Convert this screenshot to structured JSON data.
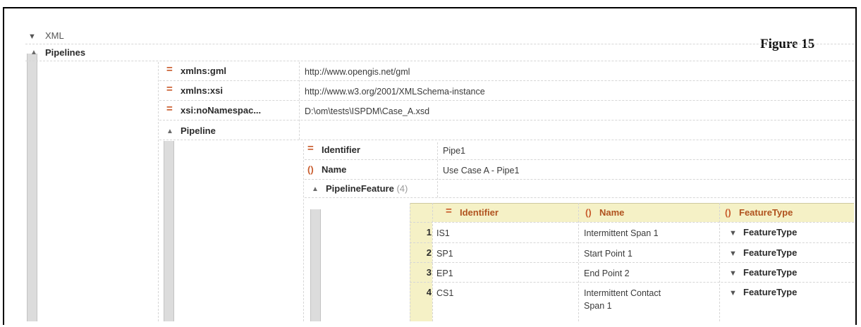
{
  "figure_label": "Figure 15",
  "root": {
    "label": "XML"
  },
  "pipelines": {
    "label": "Pipelines",
    "attributes": [
      {
        "name": "xmlns:gml",
        "value": "http://www.opengis.net/gml"
      },
      {
        "name": "xmlns:xsi",
        "value": "http://www.w3.org/2001/XMLSchema-instance"
      },
      {
        "name": "xsi:noNamespac...",
        "value": "D:\\om\\tests\\ISPDM\\Case_A.xsd"
      }
    ],
    "pipeline": {
      "label": "Pipeline",
      "identifier": {
        "name": "Identifier",
        "value": "Pipe1"
      },
      "name": {
        "name": "Name",
        "value": "Use Case A - Pipe1"
      },
      "feature": {
        "label": "PipelineFeature",
        "count": "(4)",
        "columns": [
          "Identifier",
          "Name",
          "FeatureType"
        ],
        "rows": [
          {
            "num": "1",
            "identifier": "IS1",
            "name": "Intermittent Span 1",
            "type": "FeatureType"
          },
          {
            "num": "2",
            "identifier": "SP1",
            "name": "Start Point 1",
            "type": "FeatureType"
          },
          {
            "num": "3",
            "identifier": "EP1",
            "name": "End Point 2",
            "type": "FeatureType"
          },
          {
            "num": "4",
            "identifier": "CS1",
            "name": "Intermittent Contact",
            "name2": "Span 1",
            "type": "FeatureType"
          }
        ]
      }
    }
  },
  "icons": {
    "attribute": "equals-icon",
    "element": "braces-icon",
    "expanded": "triangle-up-icon",
    "collapsed": "xml-node-icon"
  }
}
